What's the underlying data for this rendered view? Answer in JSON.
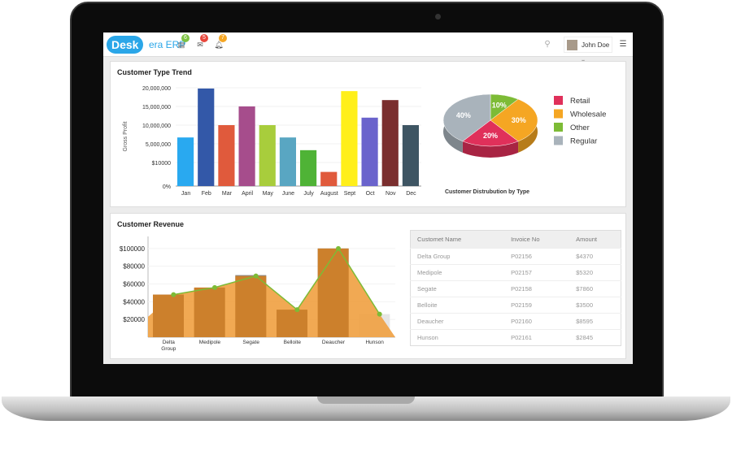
{
  "header": {
    "logo": "Desk",
    "logo_suffix": "era ERP",
    "user_name": "John Doe",
    "icons": [
      {
        "name": "tasks-icon",
        "badge": "6",
        "color": "#7dc242"
      },
      {
        "name": "mail-icon",
        "badge": "5",
        "color": "#e8473c"
      },
      {
        "name": "bell-icon",
        "badge": "7",
        "color": "#f5a623"
      }
    ]
  },
  "trend": {
    "title": "Customer Type Trend",
    "chart_data": {
      "type": "bar",
      "title": "Customer Type Trend",
      "ylabel": "Gross Profit",
      "yticks": [
        {
          "value": 0,
          "label": "0%"
        },
        {
          "value": 10000,
          "label": "$10000"
        },
        {
          "value": 5000000,
          "label": "5,000,000"
        },
        {
          "value": 10000000,
          "label": "10,000,000"
        },
        {
          "value": 15000000,
          "label": "15,000,000"
        },
        {
          "value": 20000000,
          "label": "20,000,000"
        }
      ],
      "categories": [
        "Jan",
        "Feb",
        "Mar",
        "April",
        "May",
        "June",
        "July",
        "August",
        "Sept",
        "Oct",
        "Nov",
        "Dec"
      ],
      "values": [
        6700000,
        19800000,
        10000000,
        15000000,
        10000000,
        6700000,
        3300000,
        6000,
        19100000,
        12000000,
        16700000,
        10000000
      ],
      "colors": [
        "#29a9f0",
        "#3358a8",
        "#e05a3c",
        "#a64d8c",
        "#a8cd3c",
        "#59a6c2",
        "#4fb336",
        "#e05a3c",
        "#ffef1a",
        "#6a63cc",
        "#7a2e2e",
        "#3e5563"
      ],
      "grid": true
    }
  },
  "distribution": {
    "caption": "Customer Distrubution by Type",
    "chart_data": {
      "type": "pie",
      "title": "Customer Distrubution by Type",
      "slices": [
        {
          "label": "Retail",
          "value": 20,
          "text": "20%",
          "color": "#e0305a"
        },
        {
          "label": "Wholesale",
          "value": 30,
          "text": "30%",
          "color": "#f5a623"
        },
        {
          "label": "Other",
          "value": 10,
          "text": "10%",
          "color": "#7dbb36"
        },
        {
          "label": "Regular",
          "value": 40,
          "text": "40%",
          "color": "#a9b3bb"
        }
      ],
      "legend": "right"
    }
  },
  "revenue": {
    "title": "Customer Revenue",
    "chart_data": {
      "type": "bar",
      "yticks": [
        "$20000",
        "$40000",
        "$60000",
        "$80000",
        "$100000"
      ],
      "ylim": [
        0,
        120000
      ],
      "categories": [
        "Delta Group",
        "Medipole",
        "Segate",
        "Belloite",
        "Deaucher",
        "Hunson"
      ],
      "series": [
        {
          "type": "bar",
          "values": [
            48000,
            55000,
            70000,
            31000,
            100000,
            26000
          ]
        },
        {
          "type": "line",
          "values": [
            48000,
            56000,
            69000,
            31000,
            100000,
            26000
          ]
        }
      ],
      "grid": true
    }
  },
  "table": {
    "columns": [
      "Customet Name",
      "Invoice No",
      "Amount"
    ],
    "rows": [
      [
        "Delta Group",
        "P02156",
        "$4370"
      ],
      [
        "Medipole",
        "P02157",
        "$5320"
      ],
      [
        "Segate",
        "P02158",
        "$7860"
      ],
      [
        "Belloite",
        "P02159",
        "$3500"
      ],
      [
        "Deaucher",
        "P02160",
        "$8595"
      ],
      [
        "Hunson",
        "P02161",
        "$2845"
      ]
    ]
  }
}
